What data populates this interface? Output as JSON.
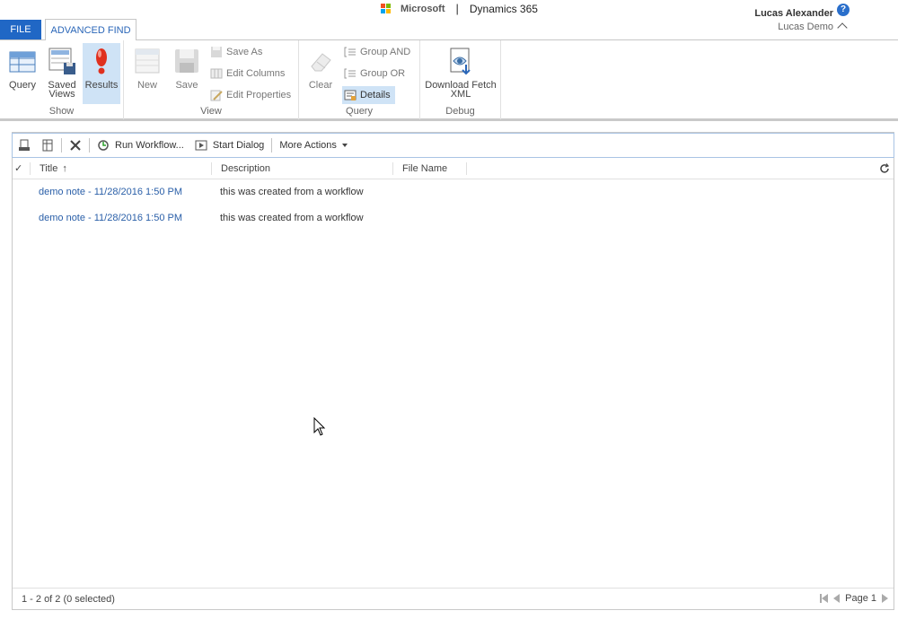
{
  "header": {
    "brand_ms": "Microsoft",
    "brand_separator": "|",
    "brand_product": "Dynamics 365",
    "user_name": "Lucas Alexander",
    "user_org": "Lucas Demo",
    "help": "?"
  },
  "tabs": [
    {
      "label": "FILE"
    },
    {
      "label": "ADVANCED FIND"
    }
  ],
  "ribbon": {
    "show": {
      "label": "Show",
      "query": "Query",
      "saved_views": "Saved Views",
      "results": "Results"
    },
    "view": {
      "label": "View",
      "new": "New",
      "save": "Save",
      "save_as": "Save As",
      "edit_columns": "Edit Columns",
      "edit_properties": "Edit Properties"
    },
    "query": {
      "label": "Query",
      "clear": "Clear",
      "group_and": "Group AND",
      "group_or": "Group OR",
      "details": "Details"
    },
    "debug": {
      "label": "Debug",
      "download_fetch": "Download Fetch XML"
    }
  },
  "commandbar": {
    "run_workflow": "Run Workflow...",
    "start_dialog": "Start Dialog",
    "more_actions": "More Actions"
  },
  "grid": {
    "columns": [
      "Title",
      "Description",
      "File Name"
    ],
    "sort_indicator": "↑",
    "rows": [
      {
        "title": "demo note - 11/28/2016 1:50 PM",
        "description": "this was created from a workflow"
      },
      {
        "title": "demo note - 11/28/2016 1:50 PM",
        "description": "this was created from a workflow"
      }
    ]
  },
  "footer": {
    "count": "1 - 2 of 2 (0 selected)",
    "page": "Page 1"
  },
  "colors": {
    "accent": "#2067c5",
    "link": "#2a5fa8",
    "selected_bg": "#cfe3f6",
    "ms_red": "#f25022",
    "ms_green": "#7fba00",
    "ms_blue": "#00a4ef",
    "ms_yellow": "#ffb900"
  }
}
